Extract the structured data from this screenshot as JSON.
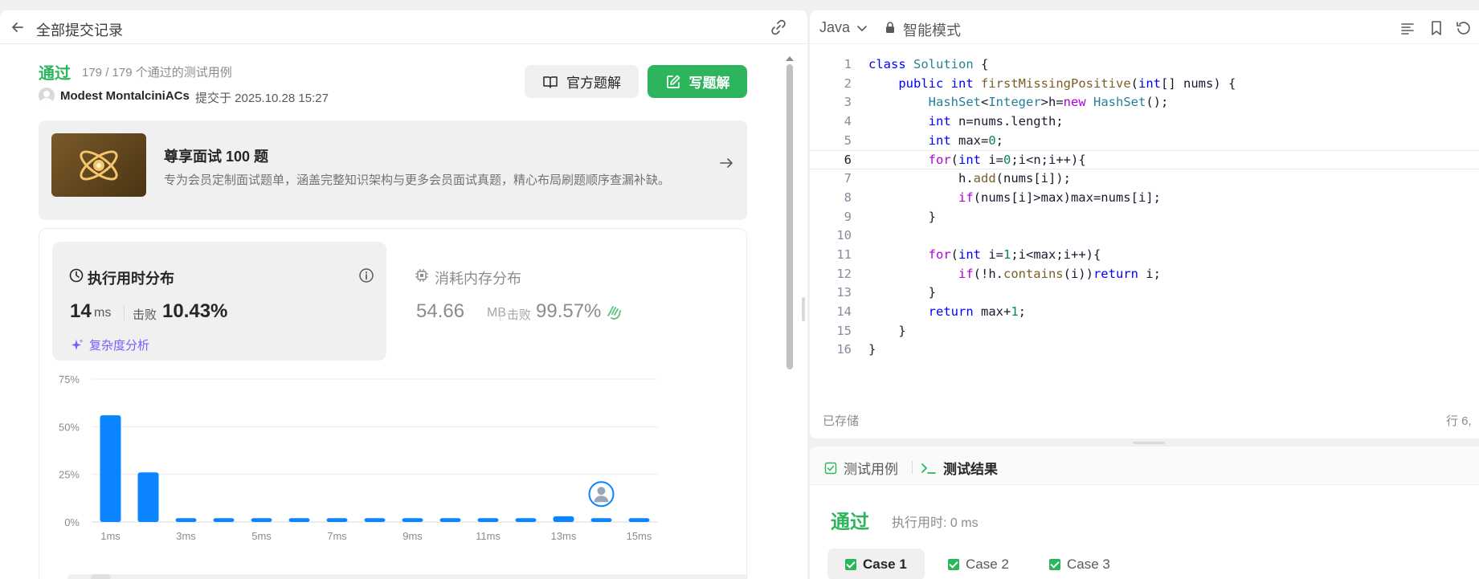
{
  "left_header": {
    "title": "全部提交记录"
  },
  "submission": {
    "status": "通过",
    "test_count": "179 / 179 个通过的测试用例",
    "user": "Modest MontalciniACs",
    "submitted_at": "提交于 2025.10.28 15:27"
  },
  "actions": {
    "official_solution": "官方题解",
    "write_solution": "写题解"
  },
  "promo": {
    "title": "尊享面试 100 题",
    "subtitle": "专为会员定制面试题单，涵盖完整知识架构与更多会员面试真题，精心布局刷题顺序查漏补缺。"
  },
  "runtime": {
    "title": "执行用时分布",
    "value": "14",
    "unit": "ms",
    "beat_label": "击败",
    "beat_value": "10.43%",
    "complexity_link": "复杂度分析"
  },
  "memory": {
    "title": "消耗内存分布",
    "value": "54.66",
    "unit": "MB",
    "beat_label": "击败",
    "beat_value": "99.57%"
  },
  "chart_data": {
    "type": "bar",
    "categories": [
      "1ms",
      "2ms",
      "3ms",
      "4ms",
      "5ms",
      "6ms",
      "7ms",
      "8ms",
      "9ms",
      "10ms",
      "11ms",
      "12ms",
      "13ms",
      "14ms",
      "15ms"
    ],
    "x_tick_labels": [
      "1ms",
      "",
      "3ms",
      "",
      "5ms",
      "",
      "7ms",
      "",
      "9ms",
      "",
      "11ms",
      "",
      "13ms",
      "",
      "15ms"
    ],
    "values": [
      56,
      26,
      2,
      2,
      2,
      2,
      2,
      2,
      2,
      2,
      2,
      2,
      3,
      2,
      2
    ],
    "y_ticks": [
      "0%",
      "25%",
      "50%",
      "75%"
    ],
    "ylim": [
      0,
      75
    ],
    "highlight_category": "14ms",
    "bar_color": "#0a84ff",
    "grid": true
  },
  "editor": {
    "language": "Java",
    "mode": "智能模式",
    "saved_status": "已存储",
    "cursor_pos": "行 6,",
    "lines": [
      "class Solution {",
      "    public int firstMissingPositive(int[] nums) {",
      "        HashSet<Integer>h=new HashSet();",
      "        int n=nums.length;",
      "        int max=0;",
      "        for(int i=0;i<n;i++){",
      "            h.add(nums[i]);",
      "            if(nums[i]>max)max=nums[i];",
      "        }",
      "",
      "        for(int i=1;i<max;i++){",
      "            if(!h.contains(i))return i;",
      "        }",
      "        return max+1;",
      "    }",
      "}"
    ]
  },
  "result_panel": {
    "tab_testcase": "测试用例",
    "tab_result": "测试结果",
    "status": "通过",
    "runtime": "执行用时: 0 ms",
    "cases": [
      "Case 1",
      "Case 2",
      "Case 3"
    ]
  },
  "colors": {
    "accent_green": "#2db55d",
    "bar_blue": "#0a84ff",
    "purple": "#7b5cff"
  }
}
